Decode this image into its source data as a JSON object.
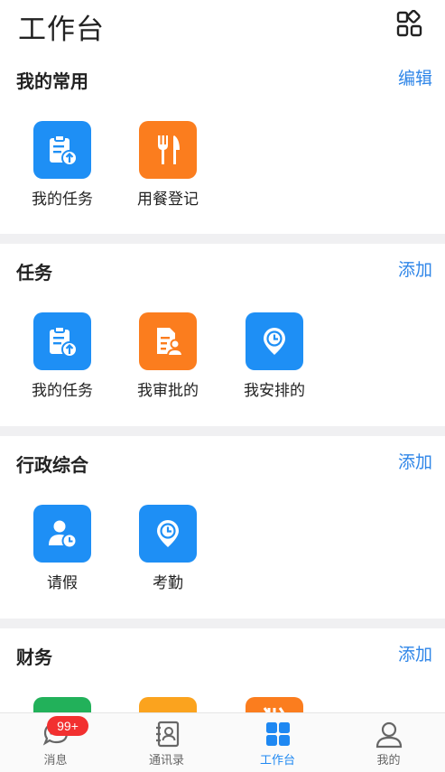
{
  "header": {
    "title": "工作台",
    "grid_icon": "apps-grid-icon"
  },
  "colors": {
    "blue": "#1e8ff5",
    "orange": "#fb7d1e",
    "green": "#22b15a",
    "link": "#2f86e8"
  },
  "sections": [
    {
      "title": "我的常用",
      "action": "编辑",
      "items": [
        {
          "label": "我的任务",
          "icon": "clipboard-upload-icon",
          "color": "#1e8ff5"
        },
        {
          "label": "用餐登记",
          "icon": "fork-knife-icon",
          "color": "#fb7d1e"
        }
      ]
    },
    {
      "title": "任务",
      "action": "添加",
      "items": [
        {
          "label": "我的任务",
          "icon": "clipboard-upload-icon",
          "color": "#1e8ff5"
        },
        {
          "label": "我审批的",
          "icon": "document-person-icon",
          "color": "#fb7d1e"
        },
        {
          "label": "我安排的",
          "icon": "clock-pin-icon",
          "color": "#1e8ff5"
        }
      ]
    },
    {
      "title": "行政综合",
      "action": "添加",
      "items": [
        {
          "label": "请假",
          "icon": "person-clock-icon",
          "color": "#1e8ff5"
        },
        {
          "label": "考勤",
          "icon": "clock-pin-icon",
          "color": "#1e8ff5"
        }
      ]
    },
    {
      "title": "财务",
      "action": "添加",
      "items": [
        {
          "icon": "finance-green-icon",
          "color": "#22b15a"
        },
        {
          "icon": "finance-orange-icon",
          "color": "#fba31e"
        },
        {
          "icon": "finance-orange2-icon",
          "color": "#fb7d1e"
        }
      ]
    }
  ],
  "bottom_nav": [
    {
      "label": "消息",
      "icon": "chat-bubble-icon",
      "badge": "99+"
    },
    {
      "label": "通讯录",
      "icon": "contacts-book-icon"
    },
    {
      "label": "工作台",
      "icon": "workbench-grid-icon",
      "active": true
    },
    {
      "label": "我的",
      "icon": "person-icon"
    }
  ]
}
